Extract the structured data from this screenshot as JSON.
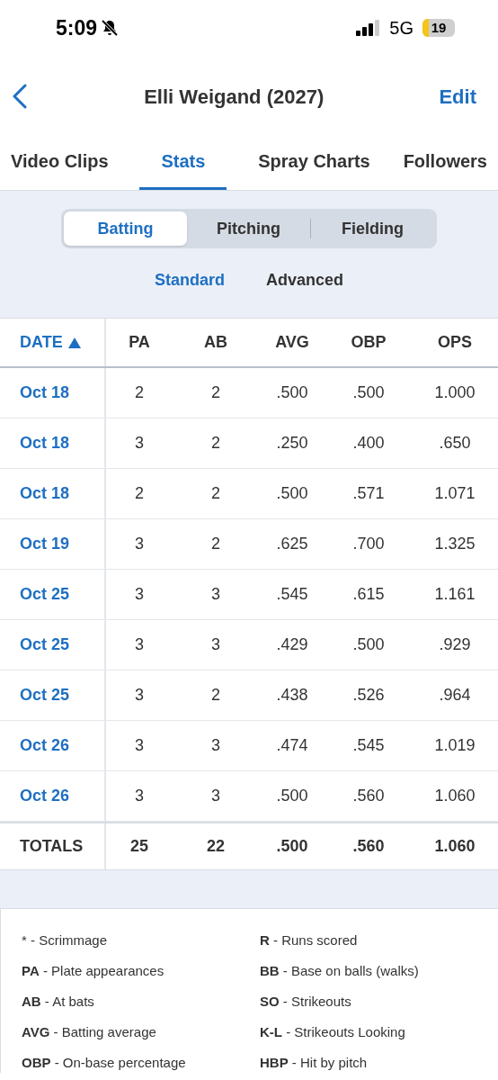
{
  "status_bar": {
    "time": "5:09",
    "network": "5G",
    "battery": "19"
  },
  "nav": {
    "title": "Elli Weigand (2027)",
    "action": "Edit"
  },
  "tabs": [
    {
      "label": "Video Clips",
      "selected": false
    },
    {
      "label": "Stats",
      "selected": true
    },
    {
      "label": "Spray Charts",
      "selected": false
    },
    {
      "label": "Followers",
      "selected": false
    }
  ],
  "segments": [
    {
      "label": "Batting",
      "selected": true
    },
    {
      "label": "Pitching",
      "selected": false
    },
    {
      "label": "Fielding",
      "selected": false
    }
  ],
  "subtabs": [
    {
      "label": "Standard",
      "selected": true
    },
    {
      "label": "Advanced",
      "selected": false
    }
  ],
  "table": {
    "columns": [
      "DATE",
      "PA",
      "AB",
      "AVG",
      "OBP",
      "OPS"
    ],
    "rows": [
      [
        "Oct 18",
        "2",
        "2",
        ".500",
        ".500",
        "1.000"
      ],
      [
        "Oct 18",
        "3",
        "2",
        ".250",
        ".400",
        ".650"
      ],
      [
        "Oct 18",
        "2",
        "2",
        ".500",
        ".571",
        "1.071"
      ],
      [
        "Oct 19",
        "3",
        "2",
        ".625",
        ".700",
        "1.325"
      ],
      [
        "Oct 25",
        "3",
        "3",
        ".545",
        ".615",
        "1.161"
      ],
      [
        "Oct 25",
        "3",
        "3",
        ".429",
        ".500",
        ".929"
      ],
      [
        "Oct 25",
        "3",
        "2",
        ".438",
        ".526",
        ".964"
      ],
      [
        "Oct 26",
        "3",
        "3",
        ".474",
        ".545",
        "1.019"
      ],
      [
        "Oct 26",
        "3",
        "3",
        ".500",
        ".560",
        "1.060"
      ]
    ],
    "totals": [
      "TOTALS",
      "25",
      "22",
      ".500",
      ".560",
      "1.060"
    ]
  },
  "legend": [
    "* - Scrimmage",
    "**R** - Runs scored",
    "**PA** - Plate appearances",
    "**BB** - Base on balls (walks)",
    "**AB** - At bats",
    "**SO** - Strikeouts",
    "**AVG** - Batting average",
    "**K-L** - Strikeouts Looking",
    "**OBP** - On-base percentage",
    "**HBP** - Hit by pitch"
  ]
}
